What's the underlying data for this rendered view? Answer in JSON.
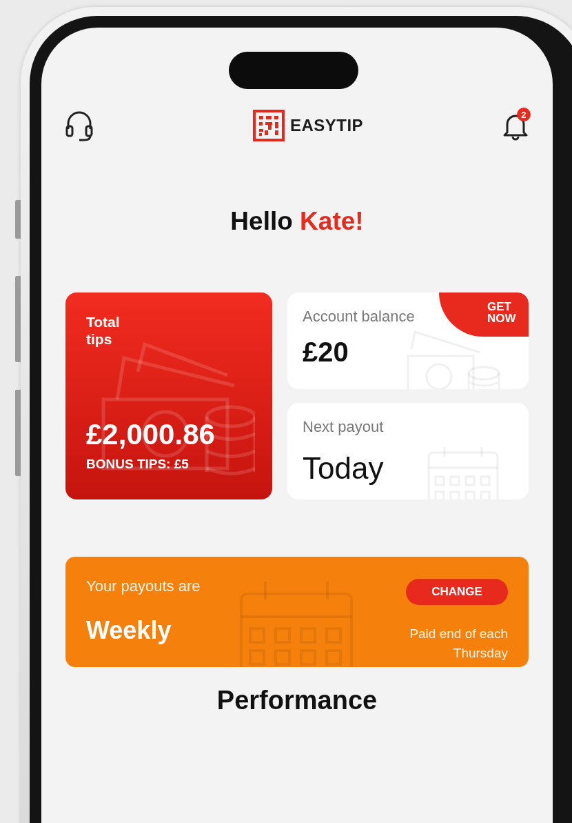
{
  "header": {
    "logo_text": "EASYTIP",
    "notification_count": "2"
  },
  "greeting": {
    "text": "Hello",
    "name": "Kate!"
  },
  "total_tips": {
    "label": "Total tips",
    "amount": "£2,000.86",
    "bonus": "BONUS TIPS: £5"
  },
  "account_balance": {
    "label": "Account balance",
    "amount": "£20",
    "badge": "GET NOW"
  },
  "next_payout": {
    "label": "Next payout",
    "value": "Today"
  },
  "payout_schedule": {
    "label": "Your payouts are",
    "frequency": "Weekly",
    "button": "CHANGE",
    "note": "Paid end of each Thursday"
  },
  "section_title": "Performance"
}
